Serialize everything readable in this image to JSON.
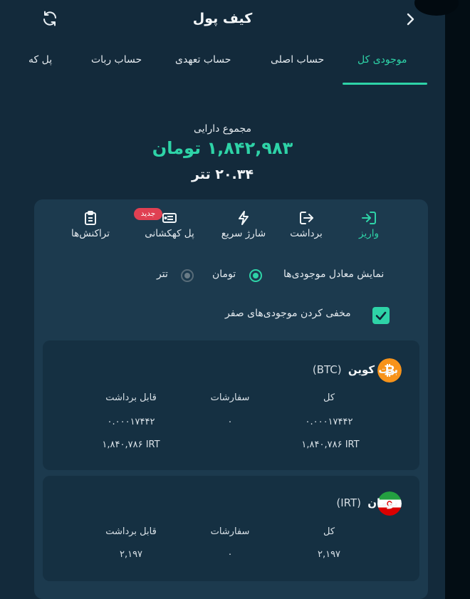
{
  "header": {
    "title": "کیف پول",
    "refresh_icon": "refresh-icon",
    "back_icon": "chevron-right-icon"
  },
  "tabs": [
    {
      "label": "موجودی کل",
      "active": true
    },
    {
      "label": "حساب اصلی",
      "active": false
    },
    {
      "label": "حساب تعهدی",
      "active": false
    },
    {
      "label": "حساب ربات",
      "active": false
    },
    {
      "label": "پل که",
      "active": false
    }
  ],
  "summary": {
    "label": "مجموع دارایی",
    "toman": "۱,۸۴۲,۹۸۳ تومان",
    "tether": "۲۰.۳۴ تتر"
  },
  "actions": [
    {
      "label": "واریز",
      "icon": "deposit-icon",
      "active": true
    },
    {
      "label": "برداشت",
      "icon": "withdraw-icon",
      "active": false
    },
    {
      "label": "شارژ سریع",
      "icon": "lightning-icon",
      "active": false
    },
    {
      "label": "پل کهکشانی",
      "icon": "ticket-icon",
      "active": false,
      "badge": "جدید"
    },
    {
      "label": "تراکنش‌ها",
      "icon": "clipboard-icon",
      "active": false
    }
  ],
  "display_options": {
    "label": "نمایش معادل موجودی‌ها",
    "options": [
      {
        "label": "تومان",
        "selected": true
      },
      {
        "label": "تتر",
        "selected": false
      }
    ],
    "hide_zero_label": "مخفی کردن موجودی‌های صفر",
    "hide_zero_checked": true
  },
  "assets": [
    {
      "name": "بیت کوین",
      "symbol": "(BTC)",
      "icon": "bitcoin-icon",
      "columns": [
        "کل",
        "سفارشات",
        "قابل برداشت"
      ],
      "total": "۰.۰۰۰۱۷۴۴۲",
      "total_irt": "۱,۸۴۰,۷۸۶ IRT",
      "orders": "۰",
      "withdrawable": "۰.۰۰۰۱۷۴۴۲",
      "withdrawable_irt": "۱,۸۴۰,۷۸۶ IRT"
    },
    {
      "name": "تومان",
      "symbol": "(IRT)",
      "icon": "iran-flag-icon",
      "columns": [
        "کل",
        "سفارشات",
        "قابل برداشت"
      ],
      "total": "۲,۱۹۷",
      "orders": "۰",
      "withdrawable": "۲,۱۹۷"
    }
  ],
  "colors": {
    "accent": "#2ed3a7",
    "background": "#132a3b",
    "card": "#1c3a4e",
    "badge": "#e04052",
    "bitcoin": "#f7931a"
  }
}
